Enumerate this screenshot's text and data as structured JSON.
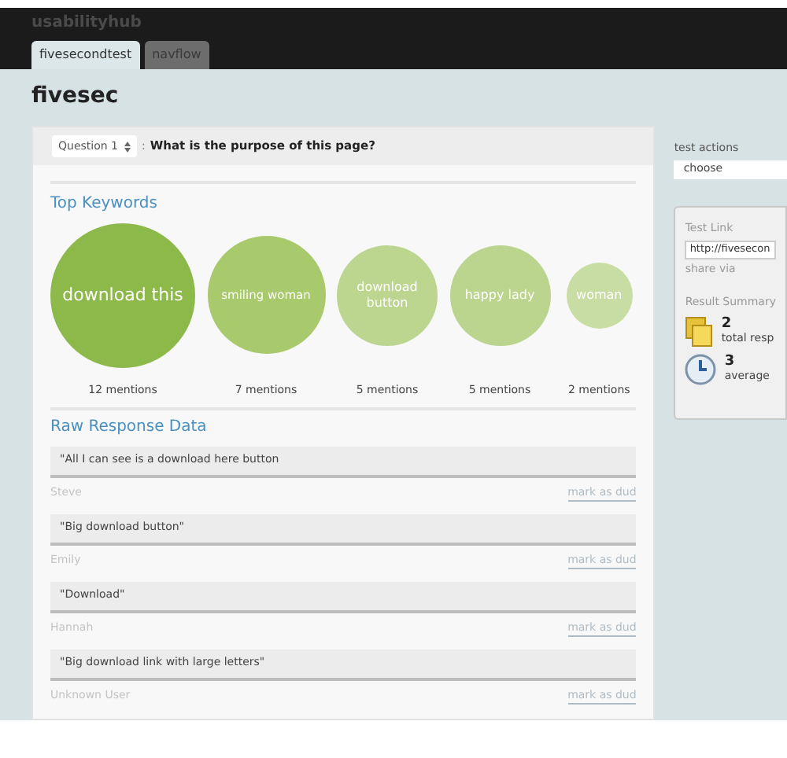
{
  "header": {
    "logo": "usabilityhub",
    "tabs": [
      {
        "label": "fivesecondtest",
        "selected": true
      },
      {
        "label": "navflow",
        "selected": false
      }
    ]
  },
  "page_title": "fivesec",
  "question": {
    "select": "Question 1",
    "separator": ":",
    "text": "What is the purpose of this page?"
  },
  "keywords": {
    "title": "Top Keywords",
    "items": [
      {
        "label": "download this",
        "mentions": "12 mentions",
        "kind": "xl",
        "color": "#8db84a"
      },
      {
        "label": "smiling woman",
        "mentions": "7 mentions",
        "kind": "lg",
        "color": "#a8c96c"
      },
      {
        "label": "download button",
        "mentions": "5 mentions",
        "kind": "md",
        "color": "#bcd68f"
      },
      {
        "label": "happy lady",
        "mentions": "5 mentions",
        "kind": "md",
        "color": "#bbd58e"
      },
      {
        "label": "woman",
        "mentions": "2 mentions",
        "kind": "sm",
        "color": "#c8dda4"
      }
    ]
  },
  "responses": {
    "title": "Raw Response Data",
    "items": [
      {
        "text": "\"All I can see is a download here button",
        "user": "Steve",
        "action": "mark as dud"
      },
      {
        "text": "\"Big download button\"",
        "user": "Emily",
        "action": "mark as dud"
      },
      {
        "text": "\"Download\"",
        "user": "Hannah",
        "action": "mark as dud"
      },
      {
        "text": "\"Big download link with large letters\"",
        "user": "Unknown User",
        "action": "mark as dud"
      }
    ]
  },
  "sidebar": {
    "actions_label": "test actions",
    "actions_select": "choose",
    "test_link_label": "Test Link",
    "test_link": "http://fivesecon",
    "share": "share via",
    "summary_label": "Result Summary",
    "stats": [
      {
        "kind": "responses",
        "value": "2",
        "label": "total resp"
      },
      {
        "kind": "time",
        "value": "3",
        "label": "average"
      }
    ]
  }
}
